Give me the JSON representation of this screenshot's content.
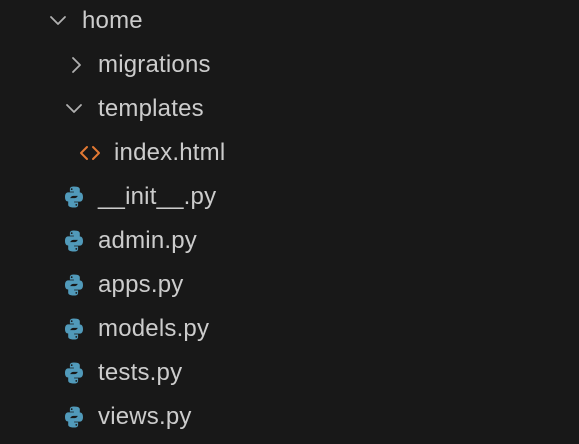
{
  "explorer": {
    "theme": {
      "background": "#181818",
      "text": "#cccccc",
      "chevron": "#b0b0b0",
      "html_icon": "#e37933",
      "python_icon": "#519aba"
    },
    "items": [
      {
        "label": "home",
        "type": "folder",
        "state": "expanded",
        "icon": "chevron-down-icon"
      },
      {
        "label": "migrations",
        "type": "folder",
        "state": "collapsed",
        "icon": "chevron-right-icon"
      },
      {
        "label": "templates",
        "type": "folder",
        "state": "expanded",
        "icon": "chevron-down-icon"
      },
      {
        "label": "index.html",
        "type": "file",
        "icon": "html-file-icon"
      },
      {
        "label": "__init__.py",
        "type": "file",
        "icon": "python-file-icon"
      },
      {
        "label": "admin.py",
        "type": "file",
        "icon": "python-file-icon"
      },
      {
        "label": "apps.py",
        "type": "file",
        "icon": "python-file-icon"
      },
      {
        "label": "models.py",
        "type": "file",
        "icon": "python-file-icon"
      },
      {
        "label": "tests.py",
        "type": "file",
        "icon": "python-file-icon"
      },
      {
        "label": "views.py",
        "type": "file",
        "icon": "python-file-icon"
      }
    ]
  }
}
